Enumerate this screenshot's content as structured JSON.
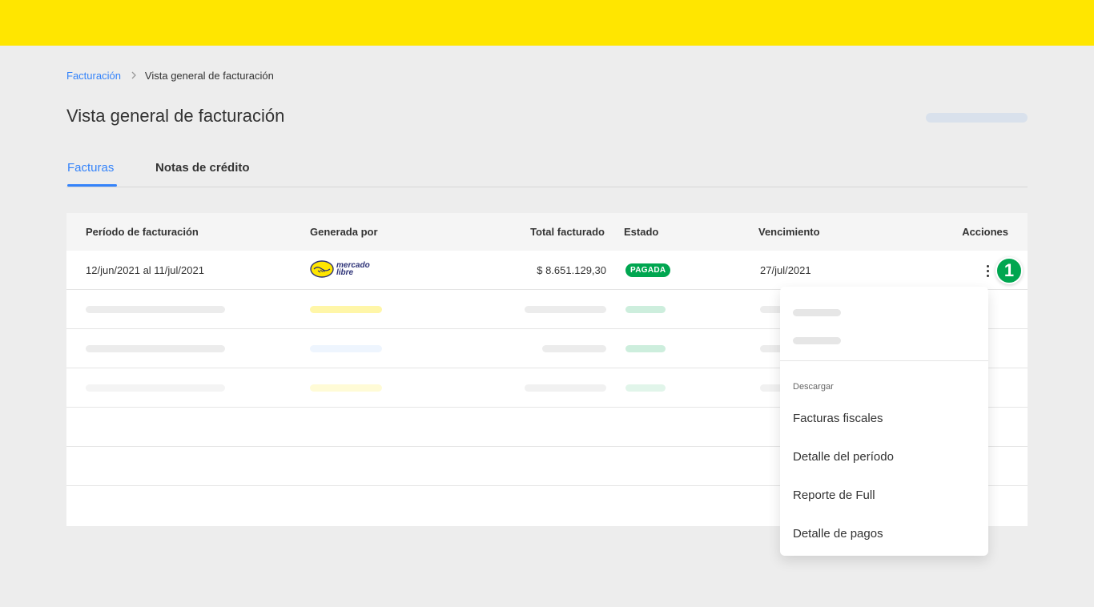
{
  "breadcrumb": {
    "parent": "Facturación",
    "current": "Vista general de facturación"
  },
  "page_title": "Vista general de facturación",
  "tabs": [
    {
      "label": "Facturas",
      "active": true
    },
    {
      "label": "Notas de crédito",
      "active": false
    }
  ],
  "table": {
    "headers": {
      "period": "Período de facturación",
      "generated_by": "Generada por",
      "total": "Total facturado",
      "status": "Estado",
      "due": "Vencimiento",
      "actions": "Acciones"
    },
    "rows": [
      {
        "period": "12/jun/2021 al 11/jul/2021",
        "generated_by_logo": {
          "line1": "mercado",
          "line2": "libre"
        },
        "total": "$ 8.651.129,30",
        "status": "PAGADA",
        "due": "27/jul/2021"
      }
    ]
  },
  "step_marker": "1",
  "actions_menu": {
    "section_label": "Descargar",
    "items": [
      "Facturas fiscales",
      "Detalle del período",
      "Reporte de Full",
      "Detalle de pagos"
    ]
  },
  "colors": {
    "header_yellow": "#ffe600",
    "accent_blue": "#3483fa",
    "status_green": "#00a650",
    "background": "#ededed"
  },
  "icons": {
    "breadcrumb_separator": "chevron-right-icon",
    "row_actions": "more-vertical-icon",
    "brand_logo": "mercado-libre-logo"
  }
}
